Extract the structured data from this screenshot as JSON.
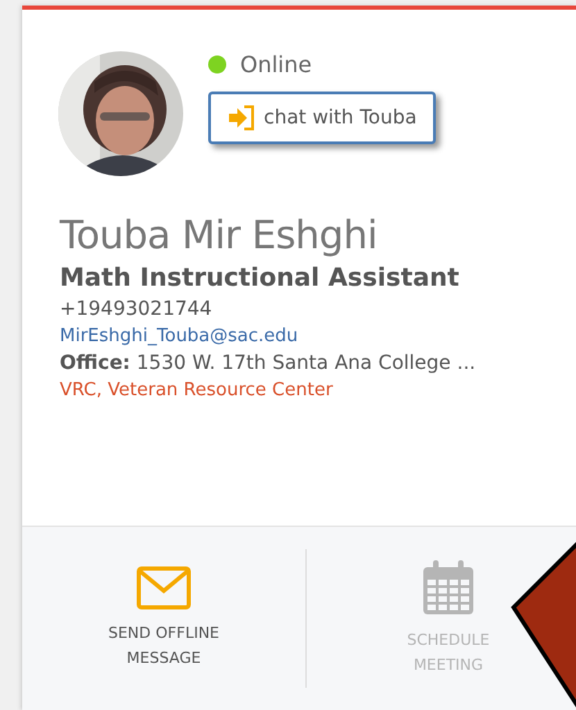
{
  "profile": {
    "kind": "picture",
    "online": true,
    "status": "Online",
    "chat_button": "chat with Touba",
    "name": "Touba Mir Eshghi",
    "title": "Math Instructional Assistant",
    "phone": "+19493021744",
    "email": "MirEshghi_Touba@sac.edu",
    "office_label": "Office:",
    "office": "1530 W. 17th Santa Ana College ...",
    "department": "VRC, Veteran Resource Center"
  },
  "actions": [
    {
      "kind": "message",
      "label": "SEND OFFLINE MESSAGE",
      "disabled": false
    },
    {
      "kind": "calendar",
      "label": "SCHEDULE MEETING",
      "disabled": true
    }
  ]
}
